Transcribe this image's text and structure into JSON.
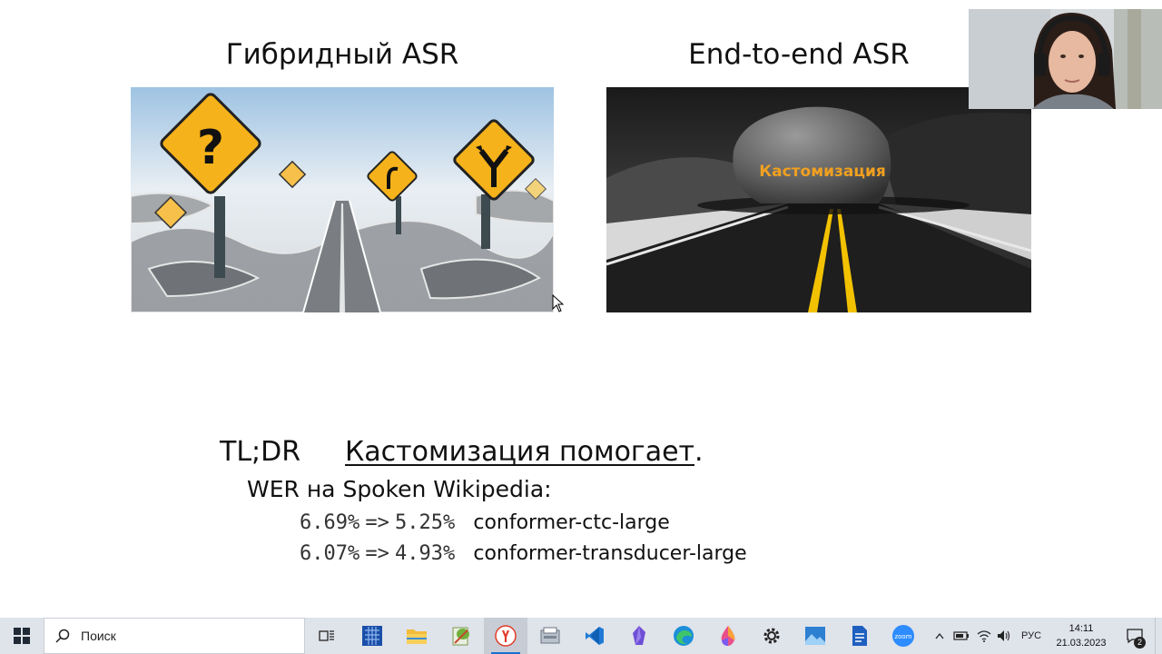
{
  "slide": {
    "left_title": "Гибридный ASR",
    "right_title": "End-to-end ASR",
    "right_picture_caption": "Кастомизация",
    "tldr_label": "TL;DR",
    "tldr_text": "Кастомизация помогает",
    "tldr_period": ".",
    "wer_title": "WER на Spoken Wikipedia:",
    "results": [
      {
        "before": "6.69%",
        "arrow": "=>",
        "after": "5.25%",
        "model": "conformer-ctc-large"
      },
      {
        "before": "6.07%",
        "arrow": "=>",
        "after": "4.93%",
        "model": "conformer-transducer-large"
      }
    ]
  },
  "taskbar": {
    "search_placeholder": "Поиск",
    "pinned_apps": [
      {
        "icon": "task-view-icon"
      },
      {
        "icon": "calculator-icon"
      },
      {
        "icon": "file-explorer-icon"
      },
      {
        "icon": "notepad-plus-plus-icon"
      },
      {
        "icon": "yandex-browser-icon",
        "active": true
      },
      {
        "icon": "scanner-app-icon"
      },
      {
        "icon": "vscode-icon"
      },
      {
        "icon": "obsidian-icon"
      },
      {
        "icon": "edge-icon"
      },
      {
        "icon": "paint-icon"
      },
      {
        "icon": "settings-gear-icon"
      },
      {
        "icon": "photos-icon"
      },
      {
        "icon": "document-icon"
      },
      {
        "icon": "zoom-icon"
      }
    ],
    "zoom_label": "zoom",
    "language": "РУС",
    "time": "14:11",
    "date": "21.03.2023",
    "notification_count": "2"
  },
  "colors": {
    "sign_yellow": "#f6b21a",
    "road_line_yellow": "#f2c200",
    "caption_orange": "#f0a020",
    "taskbar_bg": "#dfe3ea",
    "accent_blue": "#1a6fd0"
  }
}
